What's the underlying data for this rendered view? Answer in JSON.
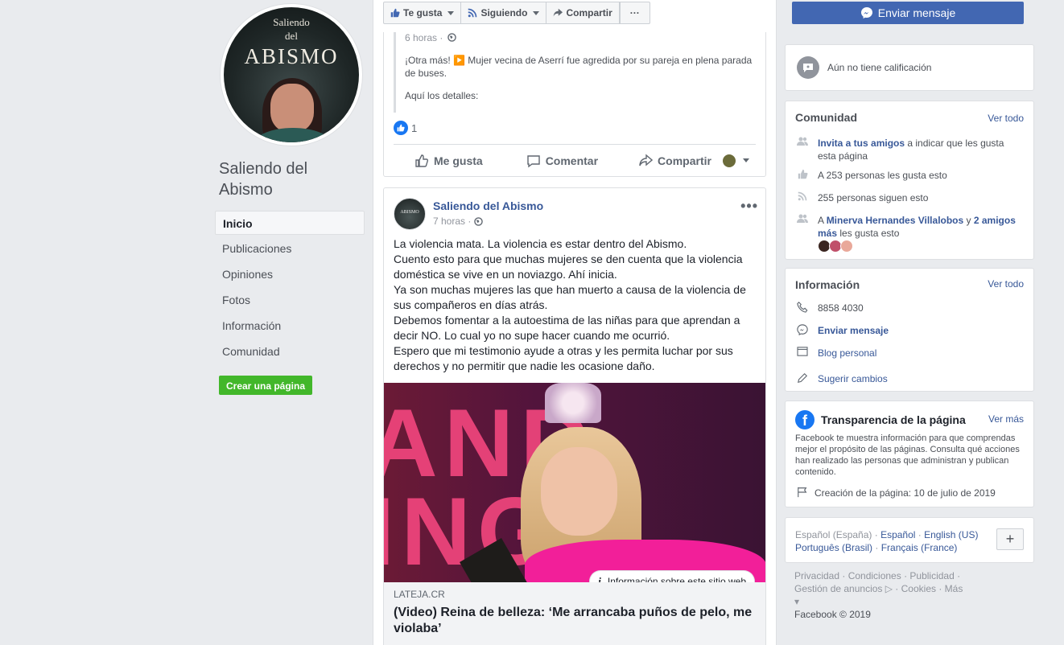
{
  "page": {
    "name": "Saliendo del Abismo",
    "profile_line1": "Saliendo",
    "profile_line2": "del",
    "profile_line3": "ABISMO"
  },
  "left_nav": {
    "items": [
      {
        "label": "Inicio"
      },
      {
        "label": "Publicaciones"
      },
      {
        "label": "Opiniones"
      },
      {
        "label": "Fotos"
      },
      {
        "label": "Información"
      },
      {
        "label": "Comunidad"
      }
    ],
    "create_page": "Crear una página"
  },
  "action_bar": {
    "liked": "Te gusta",
    "following": "Siguiendo",
    "share": "Compartir",
    "more": "···",
    "send_message": "Enviar mensaje"
  },
  "post1": {
    "shared_time": "6 horas ·",
    "shared_text": "¡Otra más! ▶️ Mujer vecina de Aserrí fue agredida por su pareja en plena parada de buses.",
    "shared_details": "Aquí los detalles:",
    "reaction_count": "1",
    "actions": {
      "like": "Me gusta",
      "comment": "Comentar",
      "share": "Compartir"
    }
  },
  "post2": {
    "author": "Saliendo del Abismo",
    "avatar_text": "ABISMO",
    "time": "7 horas ·",
    "paragraphs": [
      "La violencia mata. La violencia es estar dentro del Abismo.",
      "Cuento esto para que muchas mujeres se den cuenta que la violencia doméstica se vive en un noviazgo. Ahí inicia.",
      "Ya son muchas mujeres las que han muerto a causa de la violencia de sus compañeros en días atrás.",
      "Debemos fomentar a la autoestima de las niñas para que aprendan a decir NO. Lo cual yo no supe hacer cuando me ocurrió.",
      "Espero que mi testimonio ayude a otras y les permita luchar por sus derechos y no permitir que nadie les ocasione daño."
    ],
    "image_text": "AND\nING",
    "site_info": "Información sobre este sitio web",
    "link_domain": "LATEJA.CR",
    "link_title": "(Video) Reina de belleza: ‘Me arrancaba puños de pelo, me violaba’"
  },
  "rating": {
    "text": "Aún no tiene calificación"
  },
  "community": {
    "title": "Comunidad",
    "see_all": "Ver todo",
    "invite_link": "Invita a tus amigos",
    "invite_rest": " a indicar que les gusta esta página",
    "likes": "A 253 personas les gusta esto",
    "follows": "255 personas siguen esto",
    "friends_prefix": "A ",
    "friend_name": "Minerva Hernandes Villalobos",
    "friends_and": " y ",
    "friends_more": "2 amigos más",
    "friends_suffix": " les gusta esto"
  },
  "info": {
    "title": "Información",
    "see_all": "Ver todo",
    "phone": "8858 4030",
    "message": "Enviar mensaje",
    "category": "Blog personal",
    "suggest": "Sugerir cambios"
  },
  "transparency": {
    "title": "Transparencia de la página",
    "see_more": "Ver más",
    "body": "Facebook te muestra información para que comprendas mejor el propósito de las páginas. Consulta qué acciones han realizado las personas que administran y publican contenido.",
    "created": "Creación de la página: 10 de julio de 2019"
  },
  "languages": {
    "current": "Español (España)",
    "sep": " · ",
    "options": [
      "Español",
      "English (US)",
      "Português (Brasil)",
      "Français (France)"
    ],
    "plus": "+"
  },
  "footer": {
    "links": "Privacidad · Condiciones · Publicidad · Gestión de anuncios ▷ · Cookies · Más ▾",
    "copyright": "Facebook © 2019"
  },
  "colors": {
    "brand": "#4267b2",
    "link": "#385898",
    "green": "#42b72a"
  }
}
